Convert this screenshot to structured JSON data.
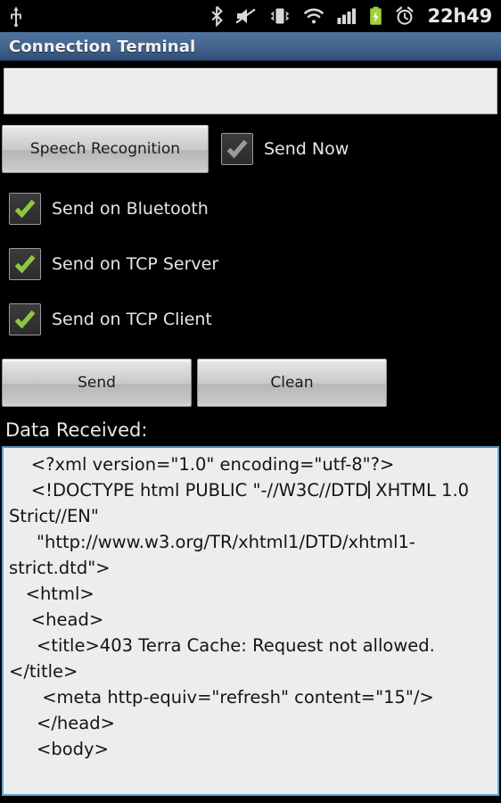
{
  "statusbar": {
    "icons_left": [
      "usb-icon"
    ],
    "icons_right": [
      "bluetooth-icon",
      "mute-icon",
      "vibrate-icon",
      "wifi-icon",
      "signal-icon",
      "battery-charging-icon",
      "alarm-icon"
    ],
    "clock": "22h49"
  },
  "titlebar": {
    "title": "Connection Terminal"
  },
  "input": {
    "value": "",
    "placeholder": ""
  },
  "buttons": {
    "speech_recognition": "Speech Recognition",
    "send": "Send",
    "clean": "Clean"
  },
  "checkboxes": [
    {
      "label": "Send Now",
      "checked": true,
      "check_color": "#9a9a9a"
    },
    {
      "label": "Send on Bluetooth",
      "checked": true,
      "check_color": "#8ec641"
    },
    {
      "label": "Send on TCP Server",
      "checked": true,
      "check_color": "#8ec641"
    },
    {
      "label": "Send on TCP Client",
      "checked": true,
      "check_color": "#8ec641"
    }
  ],
  "received": {
    "label": "Data Received:",
    "text_before_caret": "    <?xml version=\"1.0\" encoding=\"utf-8\"?>\n    <!DOCTYPE html PUBLIC \"-//W3C//DTD",
    "text_after_caret": " XHTML 1.0 Strict//EN\"\n     \"http://www.w3.org/TR/xhtml1/DTD/xhtml1-strict.dtd\">\n   <html>\n    <head>\n     <title>403 Terra Cache: Request not allowed.</title>\n      <meta http-equiv=\"refresh\" content=\"15\"/>\n     </head>\n     <body>"
  },
  "colors": {
    "titlebar_top": "#50739f",
    "titlebar_bottom": "#2b4870",
    "focus_border": "#63a6cd",
    "check_green": "#8ec641",
    "background": "#000000"
  }
}
